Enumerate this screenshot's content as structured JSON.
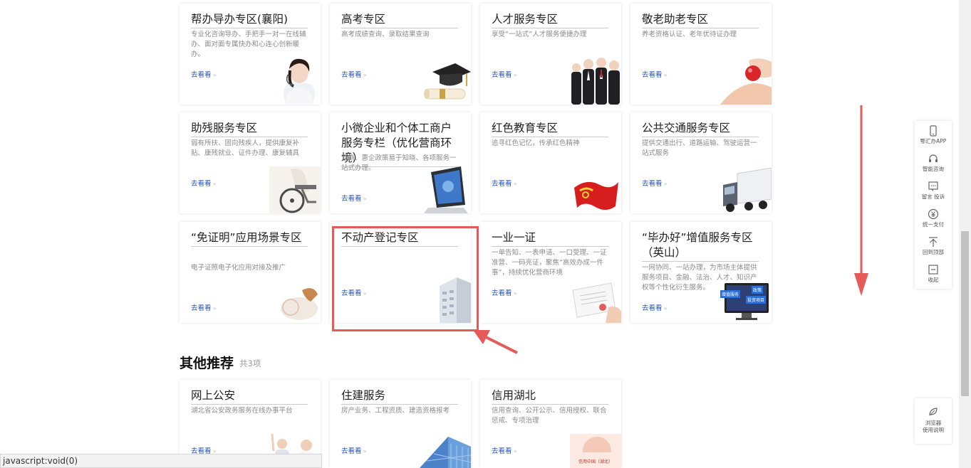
{
  "link_label": "去看看",
  "link_arrows": "›››",
  "zones": [
    {
      "title": "帮办导办专区(襄阳)",
      "desc": "专业化咨询导办、手把手一对一在线辅办、面对面专属快办和心连心创新暖办。",
      "icon": "customer-service-agent-illustration"
    },
    {
      "title": "高考专区",
      "desc": "高考成绩查询、录取结果查询",
      "icon": "graduation-cap-illustration"
    },
    {
      "title": "人才服务专区",
      "desc": "享受“一站式”人才服务便捷办理",
      "icon": "business-people-illustration"
    },
    {
      "title": "敬老助老专区",
      "desc": "养老资格认证、老年优待证办理",
      "icon": "helping-hands-illustration"
    },
    {
      "title": "助残服务专区",
      "desc": "弱有所扶、固向残疾人，提供康复补贴、康残就业、证件办理、康复辅具",
      "icon": "wheelchair-illustration"
    },
    {
      "title": "小微企业和个体工商户服务专栏（优化营商环境）",
      "desc": "营商、惠企政策易于知晓、各项服务一站式办理。",
      "icon": "laptop-illustration"
    },
    {
      "title": "红色教育专区",
      "desc": "追寻红色记忆，传承红色精神",
      "icon": "red-flag-illustration"
    },
    {
      "title": "公共交通服务专区",
      "desc": "提供交通出行、道路运输、驾驶运营一站式服务",
      "icon": "truck-illustration"
    },
    {
      "title": "“免证明”应用场景专区",
      "desc": "电子证照电子化应用对接及推广",
      "icon": "seal-stamp-illustration"
    },
    {
      "title": "不动产登记专区",
      "desc": "",
      "icon": "building-illustration"
    },
    {
      "title": "一业一证",
      "desc": "一单告知、一表申请、一口受理、一证准营、一码亮证，聚焦“高效办成一件事”，持续优化营商环境",
      "icon": "certificate-illustration"
    },
    {
      "title": "“毕办好”增值服务专区（英山）",
      "desc": "一网协同、一站办理，为市场主体提供服务项目、金融、法治、人才、知识产权等个性化衍生服务。",
      "icon": "monitor-illustration",
      "monitor_tags": [
        "增值服务",
        "政策",
        "投资项目"
      ]
    }
  ],
  "other": {
    "title": "其他推荐",
    "count": "共3项",
    "items": [
      {
        "title": "网上公安",
        "desc": "湖北省公安政务服务在线办事平台",
        "icon": "police-people-illustration"
      },
      {
        "title": "住建服务",
        "desc": "房产业务、工程资质、建造资格报考",
        "icon": "skyscraper-illustration"
      },
      {
        "title": "信用湖北",
        "desc": "信用查询、公开公示、信用授权、联合惩戒、专项治理",
        "icon": "credit-badge-illustration",
        "badge_text": "信用中国（湖北）"
      }
    ]
  },
  "sidebar": [
    {
      "label": "鄂汇办APP",
      "icon": "mobile-phone-icon"
    },
    {
      "label": "智能咨询",
      "icon": "headset-icon"
    },
    {
      "label": "留言 投诉",
      "icon": "message-icon"
    },
    {
      "label": "统一支付",
      "icon": "yuan-icon"
    },
    {
      "label": "回到顶部",
      "icon": "back-to-top-icon"
    },
    {
      "label": "收起",
      "icon": "collapse-icon"
    }
  ],
  "browser_guide": {
    "line1": "浏览器",
    "line2": "使用说明",
    "icon": "leaf-icon"
  },
  "status_bar": "javascript:void(0)",
  "colors": {
    "link": "#2c55b8",
    "annotation": "#e65a5a",
    "title_text": "#222222",
    "desc_text": "#8a8a8a"
  }
}
